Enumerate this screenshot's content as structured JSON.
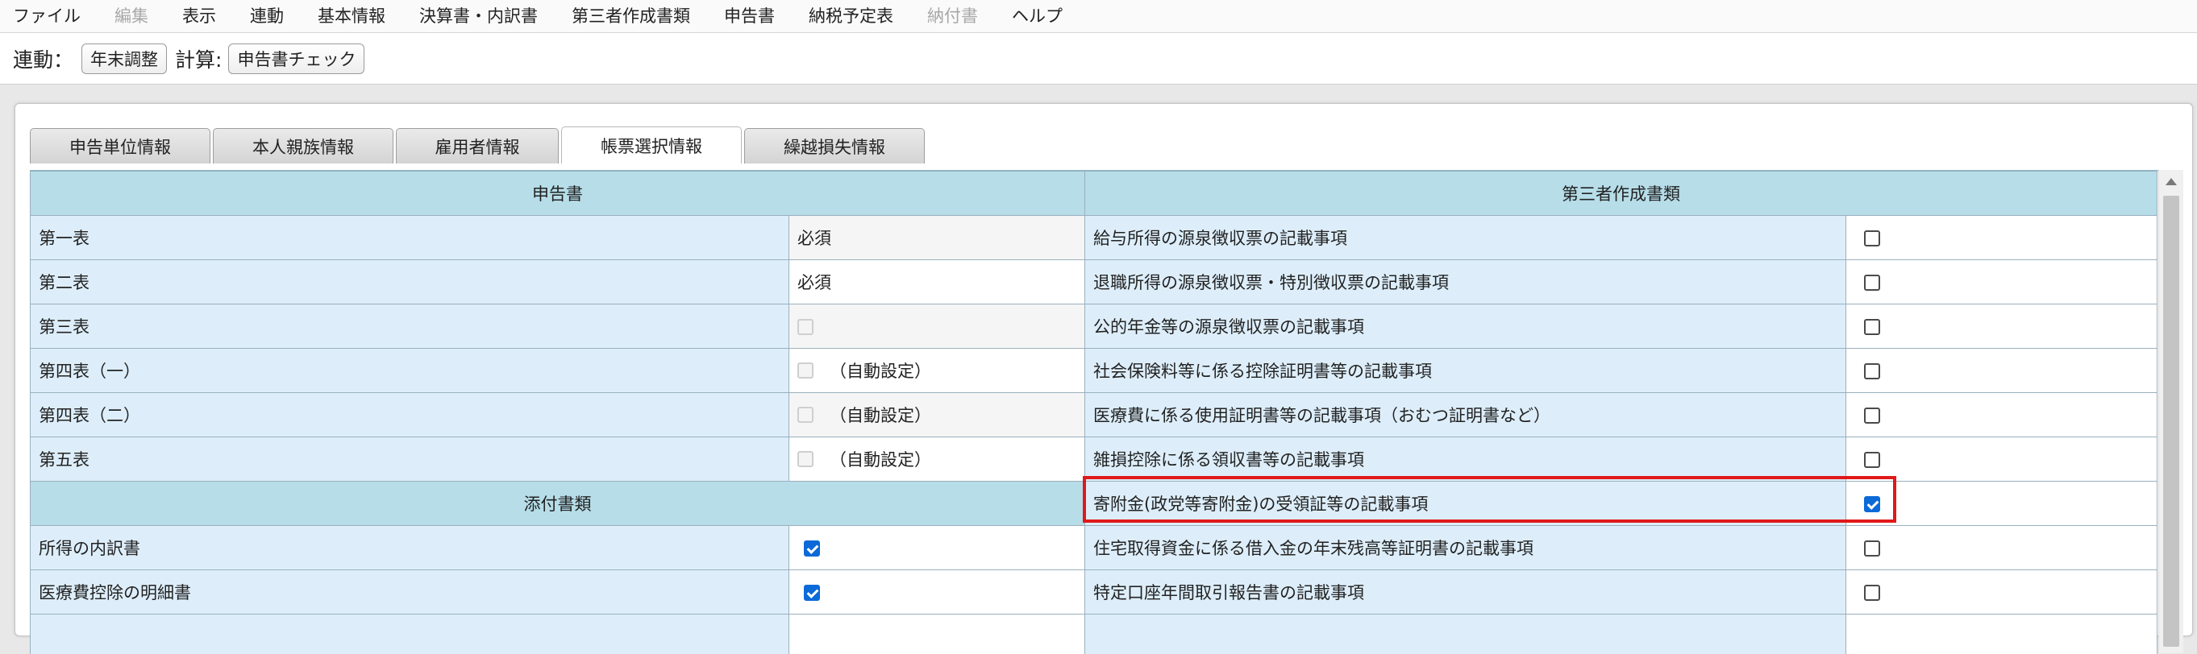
{
  "menu": {
    "items": [
      {
        "label": "ファイル",
        "disabled": false
      },
      {
        "label": "編集",
        "disabled": true
      },
      {
        "label": "表示",
        "disabled": false
      },
      {
        "label": "連動",
        "disabled": false
      },
      {
        "label": "基本情報",
        "disabled": false
      },
      {
        "label": "決算書・内訳書",
        "disabled": false
      },
      {
        "label": "第三者作成書類",
        "disabled": false
      },
      {
        "label": "申告書",
        "disabled": false
      },
      {
        "label": "納税予定表",
        "disabled": false
      },
      {
        "label": "納付書",
        "disabled": true
      },
      {
        "label": "ヘルプ",
        "disabled": false
      }
    ]
  },
  "toolbar": {
    "link_label": "連動：",
    "year_end_button": "年末調整",
    "calc_label": "計算:",
    "check_button": "申告書チェック"
  },
  "tabs": [
    {
      "label": "申告単位情報",
      "active": false
    },
    {
      "label": "本人親族情報",
      "active": false
    },
    {
      "label": "雇用者情報",
      "active": false
    },
    {
      "label": "帳票選択情報",
      "active": true
    },
    {
      "label": "繰越損失情報",
      "active": false
    }
  ],
  "grid": {
    "left_header": "申告書",
    "right_header": "第三者作成書類",
    "attachments_header": "添付書類",
    "required_text": "必須",
    "auto_text": "（自動設定）",
    "returns": [
      {
        "label": "第一表"
      },
      {
        "label": "第二表"
      },
      {
        "label": "第三表"
      },
      {
        "label": "第四表（一）"
      },
      {
        "label": "第四表（二）"
      },
      {
        "label": "第五表"
      }
    ],
    "attachments": [
      {
        "label": "所得の内訳書",
        "checked": true
      },
      {
        "label": "医療費控除の明細書",
        "checked": true
      }
    ],
    "third_party": [
      {
        "label": "給与所得の源泉徴収票の記載事項",
        "checked": false
      },
      {
        "label": "退職所得の源泉徴収票・特別徴収票の記載事項",
        "checked": false
      },
      {
        "label": "公的年金等の源泉徴収票の記載事項",
        "checked": false
      },
      {
        "label": "社会保険料等に係る控除証明書等の記載事項",
        "checked": false
      },
      {
        "label": "医療費に係る使用証明書等の記載事項（おむつ証明書など）",
        "checked": false
      },
      {
        "label": "雑損控除に係る領収書等の記載事項",
        "checked": false
      },
      {
        "label": "寄附金(政党等寄附金)の受領証等の記載事項",
        "checked": true
      },
      {
        "label": "住宅取得資金に係る借入金の年末残高等証明書の記載事項",
        "checked": false
      },
      {
        "label": "特定口座年間取引報告書の記載事項",
        "checked": false
      }
    ]
  }
}
